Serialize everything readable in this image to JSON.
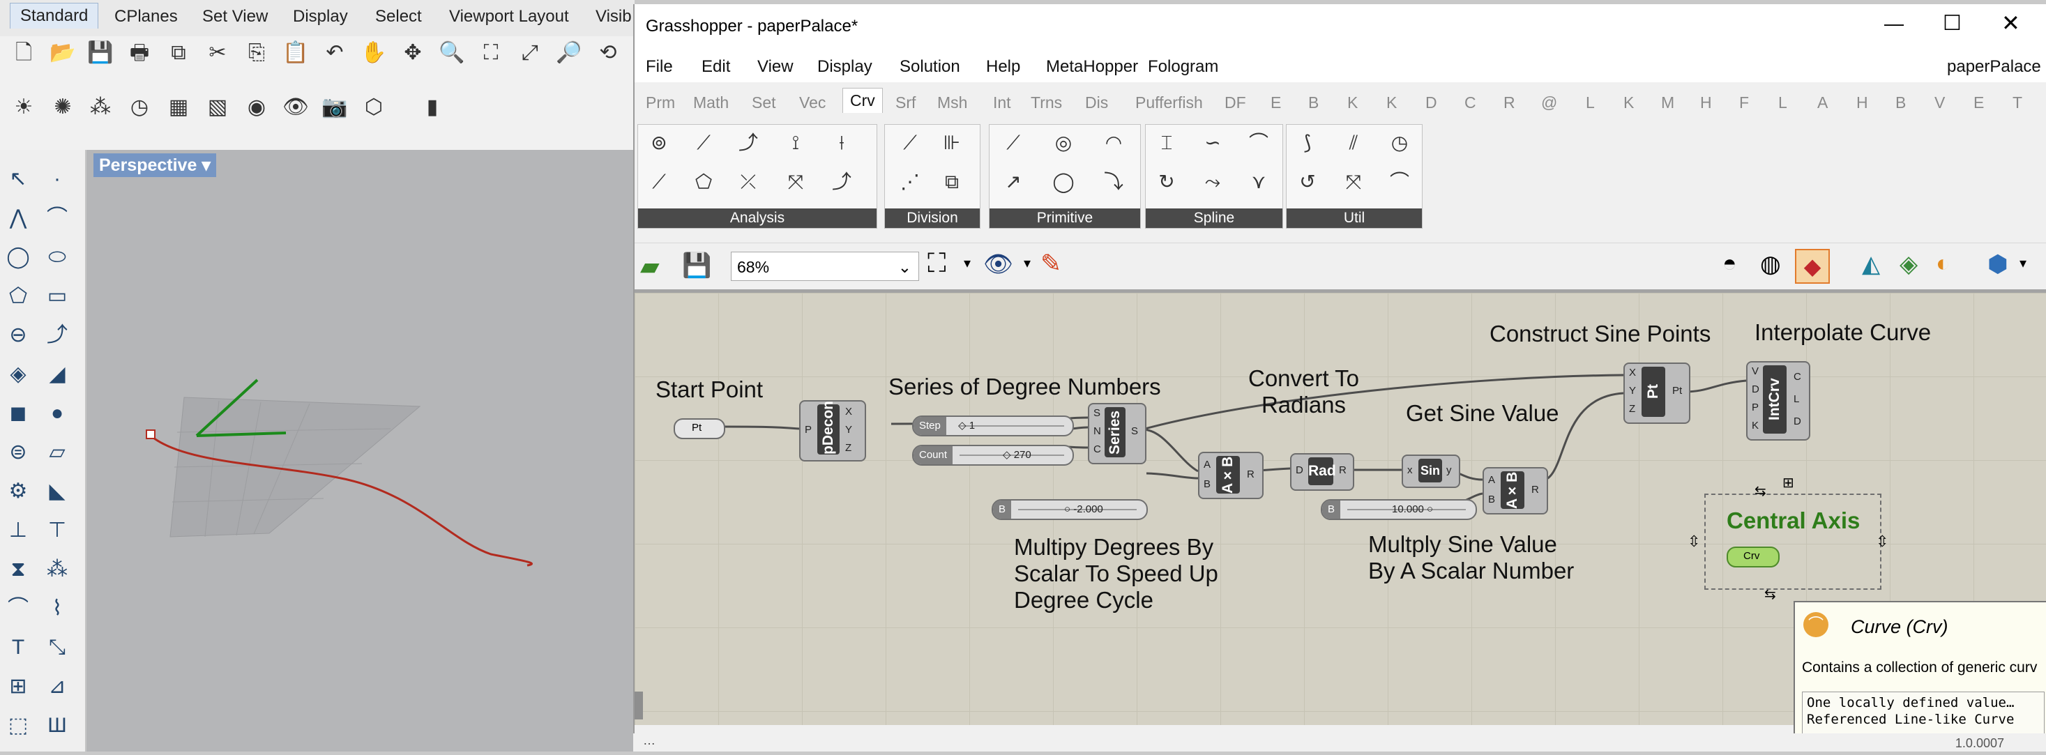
{
  "rhino": {
    "tabs": [
      "Standard",
      "CPlanes",
      "Set View",
      "Display",
      "Select",
      "Viewport Layout",
      "Visib"
    ],
    "viewport_label": "Perspective"
  },
  "gh": {
    "title": "Grasshopper - paperPalace*",
    "doc_name": "paperPalace",
    "menu": [
      "File",
      "Edit",
      "View",
      "Display",
      "Solution",
      "Help",
      "MetaHopper",
      "Fologram"
    ],
    "tabs": [
      "Prm",
      "Math",
      "Set",
      "Vec",
      "Crv",
      "Srf",
      "Msh",
      "Int",
      "Trns",
      "Dis",
      "Pufferfish",
      "DF",
      "E",
      "B",
      "K",
      "K",
      "D",
      "C",
      "R",
      "@",
      "L",
      "K",
      "M",
      "H",
      "F",
      "L",
      "A",
      "H",
      "B",
      "V",
      "E",
      "T"
    ],
    "active_tab": "Crv",
    "panels": [
      "Analysis",
      "Division",
      "Primitive",
      "Spline",
      "Util"
    ],
    "zoom": "68%",
    "groups": {
      "start_point": "Start Point",
      "series": "Series of Degree Numbers",
      "convert": "Convert To\nRadians",
      "construct": "Construct Sine Points",
      "interpolate": "Interpolate Curve",
      "get_sine": "Get Sine Value",
      "multiply_deg": "Multipy Degrees By\nScalar To Speed Up\nDegree Cycle",
      "multiply_sine": "Multply Sine Value\nBy A Scalar Number",
      "central_axis": "Central Axis"
    },
    "components": {
      "pt_param": "Pt",
      "pdecon": "pDecon",
      "series": "Series",
      "axb1": "A×B",
      "rad": "Rad",
      "sin": "Sin",
      "axb2": "A×B",
      "pt": "Pt",
      "intcrv": "IntCrv",
      "crv": "Crv"
    },
    "sliders": {
      "step_label": "Step",
      "step_value": "1",
      "count_label": "Count",
      "count_value": "270",
      "b1_label": "B",
      "b1_value": "-2.000",
      "b2_label": "B",
      "b2_value": "10.000"
    },
    "tooltip": {
      "title": "Curve (Crv)",
      "desc": "Contains a collection of generic curv",
      "line1": "One locally defined value…",
      "line2": "Referenced Line-like Curve"
    },
    "status": "1.0.0007"
  },
  "colors": {
    "accent": "#7696c4",
    "curve": "#b22a1e",
    "group_green": "#2e7d1a"
  }
}
